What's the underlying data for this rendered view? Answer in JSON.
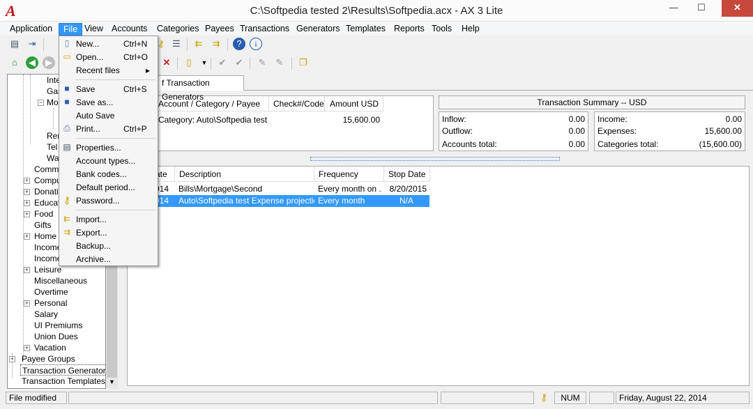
{
  "window": {
    "title": "C:\\Softpedia tested 2\\Results\\Softpedia.acx - AX 3 Lite",
    "logo": "A",
    "minimize": "—",
    "maximize": "☐",
    "close": "✕"
  },
  "menubar": [
    "Application",
    "File",
    "View",
    "Accounts",
    "Categories",
    "Payees",
    "Transactions",
    "Generators",
    "Templates",
    "Reports",
    "Tools",
    "Help"
  ],
  "file_menu": {
    "items": [
      {
        "label": "New...",
        "shortcut": "Ctrl+N",
        "icon": "new-document-icon"
      },
      {
        "label": "Open...",
        "shortcut": "Ctrl+O",
        "icon": "open-folder-icon"
      },
      {
        "label": "Recent files",
        "shortcut": "▸",
        "icon": ""
      },
      {
        "label": "Save",
        "shortcut": "Ctrl+S",
        "icon": "save-icon"
      },
      {
        "label": "Save as...",
        "shortcut": "",
        "icon": "save-as-icon"
      },
      {
        "label": "Auto Save",
        "shortcut": "",
        "icon": ""
      },
      {
        "label": "Print...",
        "shortcut": "Ctrl+P",
        "icon": "printer-icon"
      },
      {
        "label": "Properties...",
        "shortcut": "",
        "icon": "properties-icon"
      },
      {
        "label": "Account types...",
        "shortcut": "",
        "icon": ""
      },
      {
        "label": "Bank codes...",
        "shortcut": "",
        "icon": ""
      },
      {
        "label": "Default period...",
        "shortcut": "",
        "icon": ""
      },
      {
        "label": "Password...",
        "shortcut": "",
        "icon": "key-icon"
      },
      {
        "label": "Import...",
        "shortcut": "",
        "icon": "import-icon"
      },
      {
        "label": "Export...",
        "shortcut": "",
        "icon": "export-icon"
      },
      {
        "label": "Backup...",
        "shortcut": "",
        "icon": ""
      },
      {
        "label": "Archive...",
        "shortcut": "",
        "icon": ""
      }
    ]
  },
  "tree": {
    "nodes": [
      {
        "label": "Inte"
      },
      {
        "label": "Gas"
      },
      {
        "label": "Mo"
      },
      {
        "label": "Ren"
      },
      {
        "label": "Tel"
      },
      {
        "label": "Wa"
      },
      {
        "label": "Commis"
      },
      {
        "label": "Compu"
      },
      {
        "label": "Donatio"
      },
      {
        "label": "Educat"
      },
      {
        "label": "Food"
      },
      {
        "label": "Gifts"
      },
      {
        "label": "Home"
      },
      {
        "label": "Income"
      },
      {
        "label": "Income"
      },
      {
        "label": "Leisure"
      },
      {
        "label": "Miscellaneous"
      },
      {
        "label": "Overtime"
      },
      {
        "label": "Personal"
      },
      {
        "label": "Salary"
      },
      {
        "label": "UI Premiums"
      },
      {
        "label": "Union Dues"
      },
      {
        "label": "Vacation"
      },
      {
        "label": "Payee Groups"
      },
      {
        "label": "Transaction Generators"
      },
      {
        "label": "Transaction Templates"
      }
    ]
  },
  "tab": {
    "label": "f Transaction Generators"
  },
  "tx_table": {
    "headers": [
      "Account / Category / Payee",
      "Check#/Code",
      "Amount USD"
    ],
    "row": {
      "account": "Category: Auto\\Softpedia test",
      "amount": "15,600.00"
    }
  },
  "summary": {
    "title": "Transaction Summary -- USD",
    "left": [
      {
        "label": "Inflow:",
        "value": "0.00"
      },
      {
        "label": "Outflow:",
        "value": "0.00"
      },
      {
        "label": "Accounts total:",
        "value": "0.00"
      }
    ],
    "right": [
      {
        "label": "Income:",
        "value": "0.00"
      },
      {
        "label": "Expenses:",
        "value": "15,600.00"
      },
      {
        "label": "Categories total:",
        "value": "(15,600.00)"
      }
    ]
  },
  "gen_table": {
    "headers": [
      "ate",
      "Description",
      "Frequency",
      "Stop Date"
    ],
    "rows": [
      {
        "date": "014",
        "description": "Bills\\Mortgage\\Second",
        "frequency": "Every month on ...",
        "stop": "8/20/2015"
      },
      {
        "date": "014",
        "description": "Auto\\Softpedia test Expense projectio...",
        "frequency": "Every month",
        "stop": "N/A"
      }
    ]
  },
  "status": {
    "left": "File modified",
    "num": "NUM",
    "date": "Friday, August 22, 2014"
  }
}
